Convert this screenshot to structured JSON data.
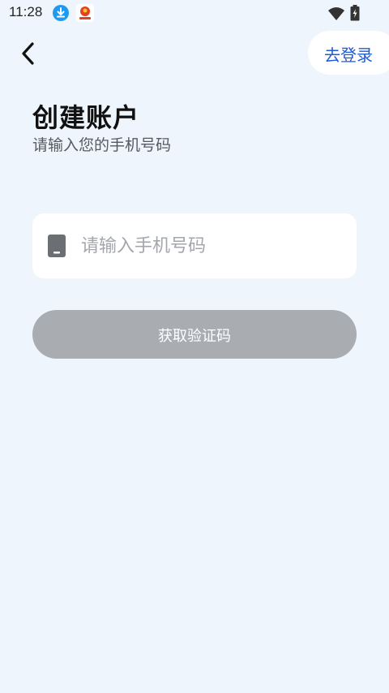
{
  "status_bar": {
    "time": "11:28",
    "download_icon": "download-circle-icon",
    "app_icon": "app-notification-icon",
    "wifi_icon": "wifi-icon",
    "battery_icon": "battery-charging-icon"
  },
  "nav": {
    "back_icon": "chevron-left-icon",
    "login_label": "去登录"
  },
  "header": {
    "title": "创建账户",
    "subtitle": "请输入您的手机号码"
  },
  "form": {
    "phone_icon": "phone-device-icon",
    "phone_placeholder": "请输入手机号码",
    "phone_value": "",
    "submit_label": "获取验证码",
    "submit_enabled": false
  },
  "colors": {
    "background": "#eff5fc",
    "accent": "#1f5ad9",
    "button_disabled": "#a9acb1",
    "card": "#ffffff"
  }
}
